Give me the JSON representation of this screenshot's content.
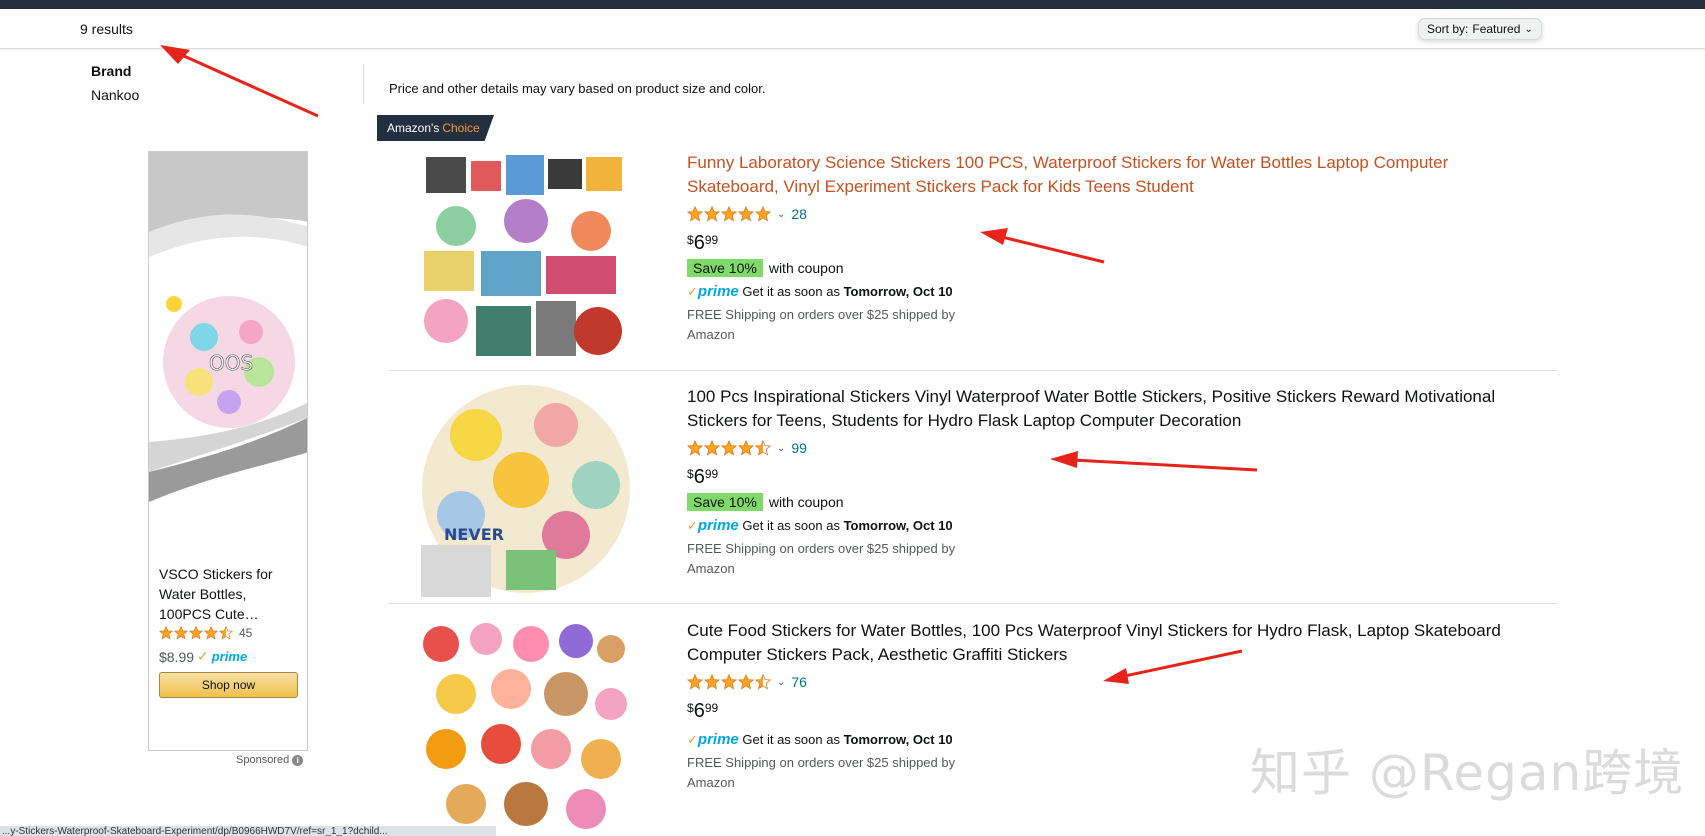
{
  "results_bar": {
    "count_text": "9 results",
    "sort_label": "Sort by:",
    "sort_value": "Featured"
  },
  "filters": {
    "brand_heading": "Brand",
    "brand_value": "Nankoo"
  },
  "ad": {
    "title": "VSCO Stickers for Water Bottles, 100PCS Cute…",
    "rating": 4.5,
    "review_count": "45",
    "price": "$8.99",
    "prime": "prime",
    "button_label": "Shop now",
    "sponsored_label": "Sponsored"
  },
  "main": {
    "price_note": "Price and other details may vary based on product size and color.",
    "badge": {
      "prefix": "Amazon's",
      "highlight": "Choice"
    }
  },
  "products": [
    {
      "title": "Funny Laboratory Science Stickers 100 PCS, Waterproof Stickers for Water Bottles Laptop Computer Skateboard, Vinyl Experiment Stickers Pack for Kids Teens Student",
      "rating": 5,
      "review_count": "28",
      "price_symbol": "$",
      "price_whole": "6",
      "price_fraction": "99",
      "coupon_save": "Save 10%",
      "coupon_text": "with coupon",
      "prime": "prime",
      "delivery_prefix": "Get it as soon as",
      "delivery_date": "Tomorrow, Oct 10",
      "shipping": "FREE Shipping on orders over $25 shipped by Amazon"
    },
    {
      "title": "100 Pcs Inspirational Stickers Vinyl Waterproof Water Bottle Stickers, Positive Stickers Reward Motivational Stickers for Teens, Students for Hydro Flask Laptop Computer Decoration",
      "rating": 4.5,
      "review_count": "99",
      "price_symbol": "$",
      "price_whole": "6",
      "price_fraction": "99",
      "coupon_save": "Save 10%",
      "coupon_text": "with coupon",
      "prime": "prime",
      "delivery_prefix": "Get it as soon as",
      "delivery_date": "Tomorrow, Oct 10",
      "shipping": "FREE Shipping on orders over $25 shipped by Amazon"
    },
    {
      "title": "Cute Food Stickers for Water Bottles, 100 Pcs Waterproof Vinyl Stickers for Hydro Flask, Laptop Skateboard Computer Stickers Pack, Aesthetic Graffiti Stickers",
      "rating": 4.5,
      "review_count": "76",
      "price_symbol": "$",
      "price_whole": "6",
      "price_fraction": "99",
      "prime": "prime",
      "delivery_prefix": "Get it as soon as",
      "delivery_date": "Tomorrow, Oct 10",
      "shipping": "FREE Shipping on orders over $25 shipped by Amazon"
    }
  ],
  "status_bar": {
    "url": "...y-Stickers-Waterproof-Skateboard-Experiment/dp/B0966HWD7V/ref=sr_1_1?dchild..."
  },
  "watermark": "知乎 @Regan跨境",
  "colors": {
    "nav": "#232f3e",
    "link_orange": "#c7511f",
    "star": "#ffa41c",
    "prime_blue": "#00a8e1",
    "coupon_green": "#7fda69",
    "annotation_red": "#e8231b"
  }
}
